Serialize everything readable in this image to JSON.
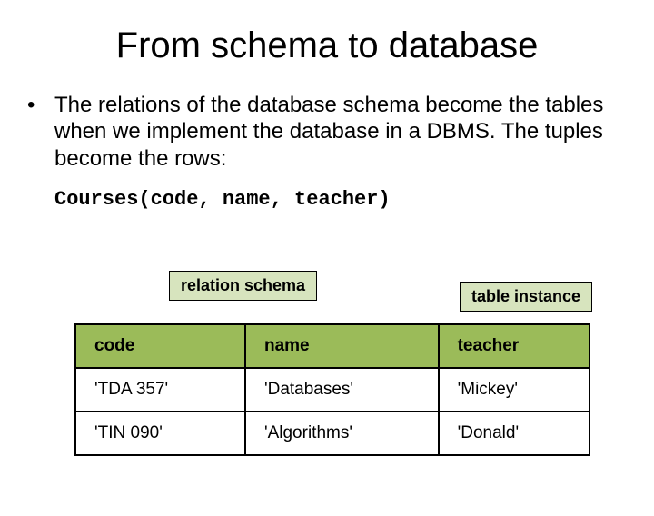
{
  "title": "From schema to database",
  "bullet_text": "The relations of the database schema become the tables when we implement the database in a DBMS. The tuples become the rows:",
  "schema_line": "Courses(code, name, teacher)",
  "relation_schema_label": "relation schema",
  "table_instance_label": "table instance",
  "table": {
    "headers": [
      "code",
      "name",
      "teacher"
    ],
    "rows": [
      [
        "'TDA 357'",
        "'Databases'",
        "'Mickey'"
      ],
      [
        "'TIN 090'",
        "'Algorithms'",
        "'Donald'"
      ]
    ]
  }
}
